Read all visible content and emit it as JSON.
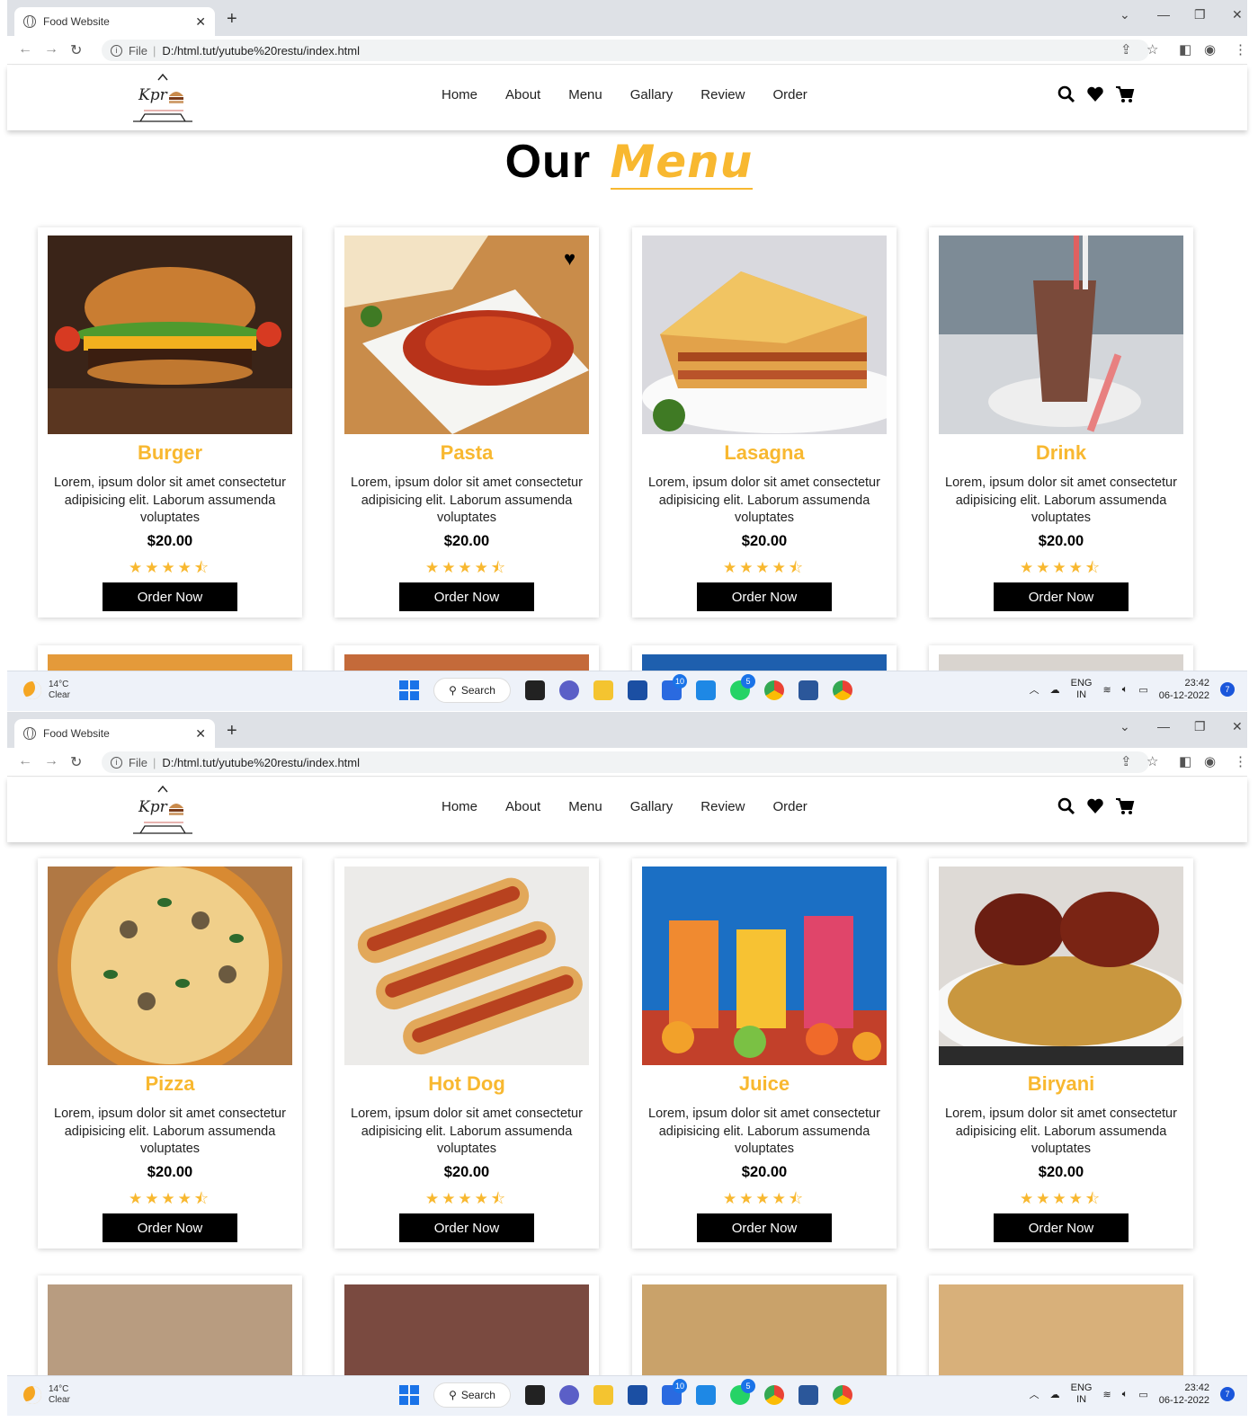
{
  "browser": {
    "tab_title": "Food Website",
    "url_prefix": "File",
    "url": "D:/html.tut/yutube%20restu/index.html"
  },
  "site": {
    "nav": [
      "Home",
      "About",
      "Menu",
      "Gallary",
      "Review",
      "Order"
    ],
    "heading_main": "Our",
    "heading_highlight": "Menu",
    "icons": [
      "search-icon",
      "heart-icon",
      "cart-icon"
    ]
  },
  "colors": {
    "accent": "#f8b830",
    "button": "#000000"
  },
  "menu_top": [
    {
      "name": "Burger",
      "desc": "Lorem, ipsum dolor sit amet consectetur adipisicing elit. Laborum assumenda voluptates",
      "price": "$20.00",
      "button": "Order Now",
      "rating": 4.5
    },
    {
      "name": "Pasta",
      "desc": "Lorem, ipsum dolor sit amet consectetur adipisicing elit. Laborum assumenda voluptates",
      "price": "$20.00",
      "button": "Order Now",
      "rating": 4.5
    },
    {
      "name": "Lasagna",
      "desc": "Lorem, ipsum dolor sit amet consectetur adipisicing elit. Laborum assumenda voluptates",
      "price": "$20.00",
      "button": "Order Now",
      "rating": 4.5
    },
    {
      "name": "Drink",
      "desc": "Lorem, ipsum dolor sit amet consectetur adipisicing elit. Laborum assumenda voluptates",
      "price": "$20.00",
      "button": "Order Now",
      "rating": 4.5
    }
  ],
  "menu_bottom": [
    {
      "name": "Pizza",
      "desc": "Lorem, ipsum dolor sit amet consectetur adipisicing elit. Laborum assumenda voluptates",
      "price": "$20.00",
      "button": "Order Now",
      "rating": 4.5
    },
    {
      "name": "Hot Dog",
      "desc": "Lorem, ipsum dolor sit amet consectetur adipisicing elit. Laborum assumenda voluptates",
      "price": "$20.00",
      "button": "Order Now",
      "rating": 4.5
    },
    {
      "name": "Juice",
      "desc": "Lorem, ipsum dolor sit amet consectetur adipisicing elit. Laborum assumenda voluptates",
      "price": "$20.00",
      "button": "Order Now",
      "rating": 4.5
    },
    {
      "name": "Biryani",
      "desc": "Lorem, ipsum dolor sit amet consectetur adipisicing elit. Laborum assumenda voluptates",
      "price": "$20.00",
      "button": "Order Now",
      "rating": 4.5
    }
  ],
  "taskbar": {
    "temperature": "14°C",
    "weather": "Clear",
    "search_label": "Search",
    "lang": "ENG",
    "region": "IN",
    "time": "23:42",
    "date": "06-12-2022",
    "notifications": "7",
    "badge_teams": "10",
    "badge_whatsapp": "5"
  }
}
